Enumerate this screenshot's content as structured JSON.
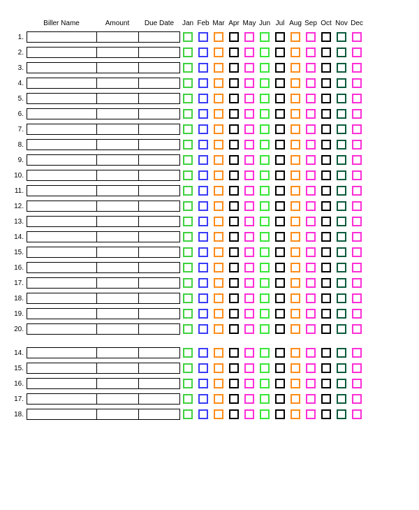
{
  "headers": {
    "biller_name": "Biller Name",
    "amount": "Amount",
    "due_date": "Due Date",
    "months": [
      "Jan",
      "Feb",
      "Mar",
      "Apr",
      "May",
      "Jun",
      "Jul",
      "Aug",
      "Sep",
      "Oct",
      "Nov",
      "Dec"
    ]
  },
  "month_colors": {
    "Jan": "#3fd13f",
    "Feb": "#3a3af7",
    "Mar": "#ff8c1a",
    "Apr": "#000000",
    "May": "#ff2ed6",
    "Jun": "#39e639",
    "Jul": "#000000",
    "Aug": "#ff8c1a",
    "Sep": "#ff2ed6",
    "Oct": "#000000",
    "Nov": "#0a5a3c",
    "Dec": "#ff2ed6"
  },
  "row_blocks": [
    [
      1,
      2,
      3,
      4,
      5,
      6,
      7,
      8,
      9,
      10,
      11,
      12,
      13,
      14,
      15,
      16,
      17,
      18,
      19,
      20
    ],
    [
      14,
      15,
      16,
      17,
      18
    ]
  ]
}
